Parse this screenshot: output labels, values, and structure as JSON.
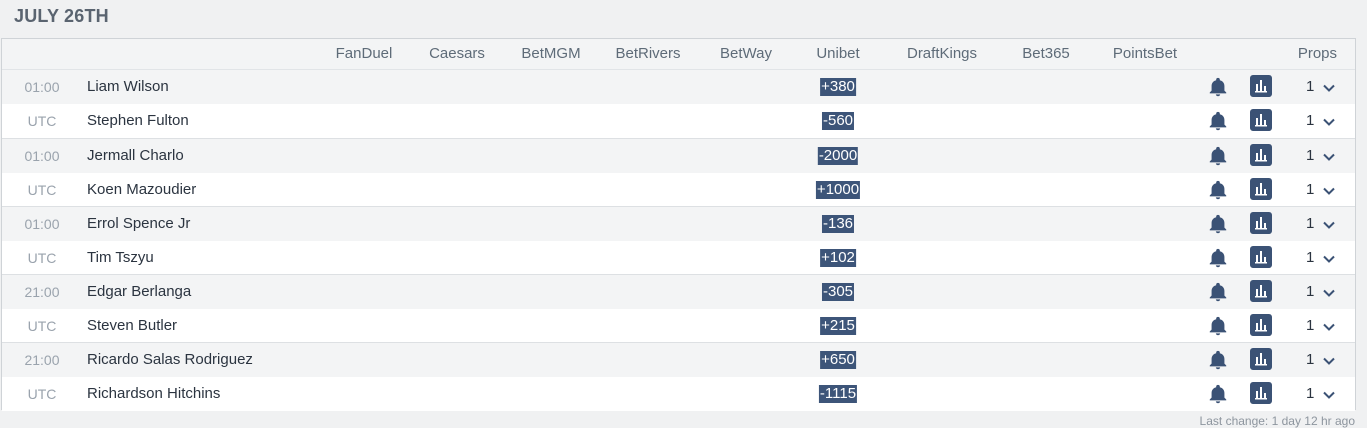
{
  "date_title": "JULY 26TH",
  "books": [
    "FanDuel",
    "Caesars",
    "BetMGM",
    "BetRivers",
    "BetWay",
    "Unibet",
    "DraftKings",
    "Bet365",
    "PointsBet"
  ],
  "props_label": "Props",
  "events": [
    {
      "time": "01:00",
      "tz": "UTC",
      "f1": "Liam Wilson",
      "o1": "+380",
      "f2": "Stephen Fulton",
      "o2": "-560",
      "p1": "1",
      "p2": "1"
    },
    {
      "time": "01:00",
      "tz": "UTC",
      "f1": "Jermall Charlo",
      "o1": "-2000",
      "f2": "Koen Mazoudier",
      "o2": "+1000",
      "p1": "1",
      "p2": "1"
    },
    {
      "time": "01:00",
      "tz": "UTC",
      "f1": "Errol Spence Jr",
      "o1": "-136",
      "f2": "Tim Tszyu",
      "o2": "+102",
      "p1": "1",
      "p2": "1"
    },
    {
      "time": "21:00",
      "tz": "UTC",
      "f1": "Edgar Berlanga",
      "o1": "-305",
      "f2": "Steven Butler",
      "o2": "+215",
      "p1": "1",
      "p2": "1"
    },
    {
      "time": "21:00",
      "tz": "UTC",
      "f1": "Ricardo Salas Rodriguez",
      "o1": "+650",
      "f2": "Richardson Hitchins",
      "o2": "-1115",
      "p1": "1",
      "p2": "1"
    }
  ],
  "footer": "Last change: 1 day 12 hr ago",
  "colors": {
    "odds_bg": "#3d5579",
    "icon": "#3b5275",
    "title": "#5a6470"
  }
}
